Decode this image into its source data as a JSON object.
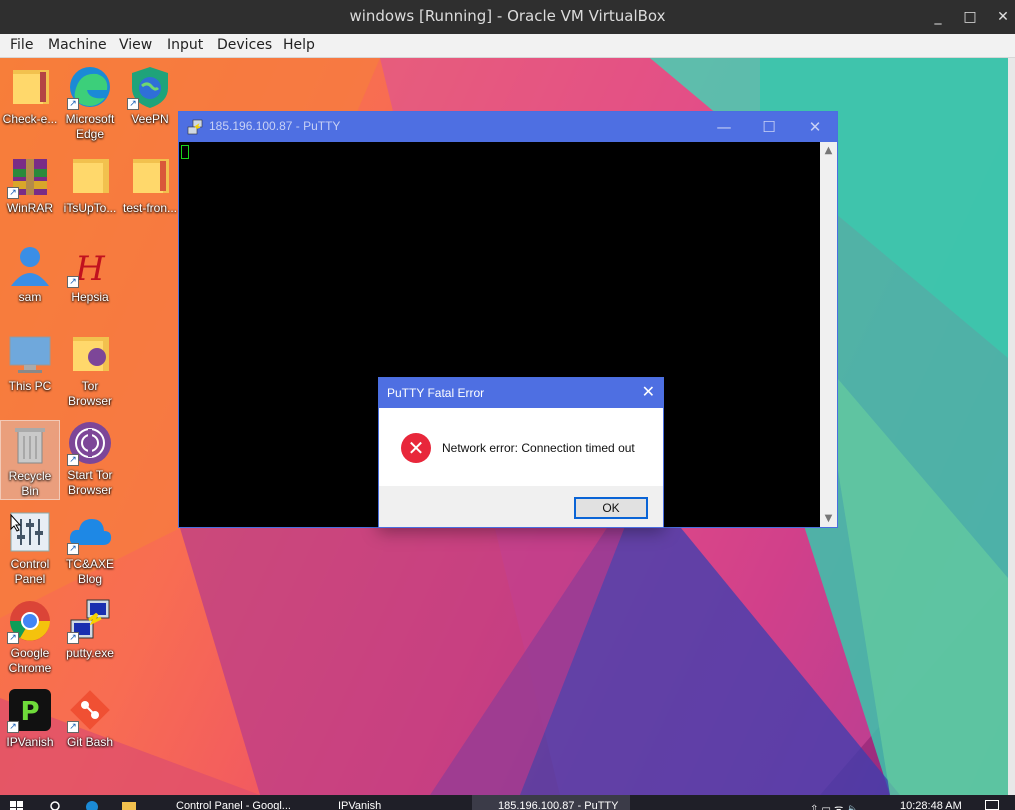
{
  "host": {
    "title": "windows [Running] - Oracle VM VirtualBox",
    "controls": {
      "minimize": "_",
      "maximize": "□",
      "close": "✕"
    },
    "menu": [
      "File",
      "Machine",
      "View",
      "Input",
      "Devices",
      "Help"
    ]
  },
  "desktop_icons": [
    {
      "label": "Check-e...",
      "icon": "folder-icon"
    },
    {
      "label": "Microsoft Edge",
      "icon": "edge-icon"
    },
    {
      "label": "VeePN",
      "icon": "veepn-icon"
    },
    {
      "label": "WinRAR",
      "icon": "winrar-icon"
    },
    {
      "label": "iTsUpTo...",
      "icon": "folder-icon"
    },
    {
      "label": "test-fron...",
      "icon": "folder-icon"
    },
    {
      "label": "sam",
      "icon": "user-icon"
    },
    {
      "label": "Hepsia",
      "icon": "hepsia-icon"
    },
    {
      "label": "This PC",
      "icon": "computer-icon"
    },
    {
      "label": "Tor Browser",
      "icon": "folder-icon"
    },
    {
      "label": "Recycle Bin",
      "icon": "recycle-bin-icon"
    },
    {
      "label": "Start Tor Browser",
      "icon": "tor-icon"
    },
    {
      "label": "Control Panel",
      "icon": "control-panel-icon"
    },
    {
      "label": "TC&AXE Blog",
      "icon": "cloud-icon"
    },
    {
      "label": "Google Chrome",
      "icon": "chrome-icon"
    },
    {
      "label": "putty.exe",
      "icon": "putty-icon"
    },
    {
      "label": "IPVanish",
      "icon": "ipvanish-icon"
    },
    {
      "label": "Git Bash",
      "icon": "git-icon"
    }
  ],
  "putty": {
    "title": "185.196.100.87 - PuTTY",
    "controls": {
      "minimize": "—",
      "maximize": "☐",
      "close": "✕"
    }
  },
  "dialog": {
    "title": "PuTTY Fatal Error",
    "close": "✕",
    "icon_glyph": "✕",
    "message": "Network error: Connection timed out",
    "ok_label": "OK"
  },
  "taskbar": {
    "items": [
      "Control Panel - Googl...",
      "IPVanish",
      "185.196.100.87 - PuTTY"
    ],
    "clock": "10:28:48 AM"
  },
  "colors": {
    "titlebar_blue": "#4e6fe2",
    "error_red": "#e8273b",
    "cursor_green": "#1bd21b"
  }
}
